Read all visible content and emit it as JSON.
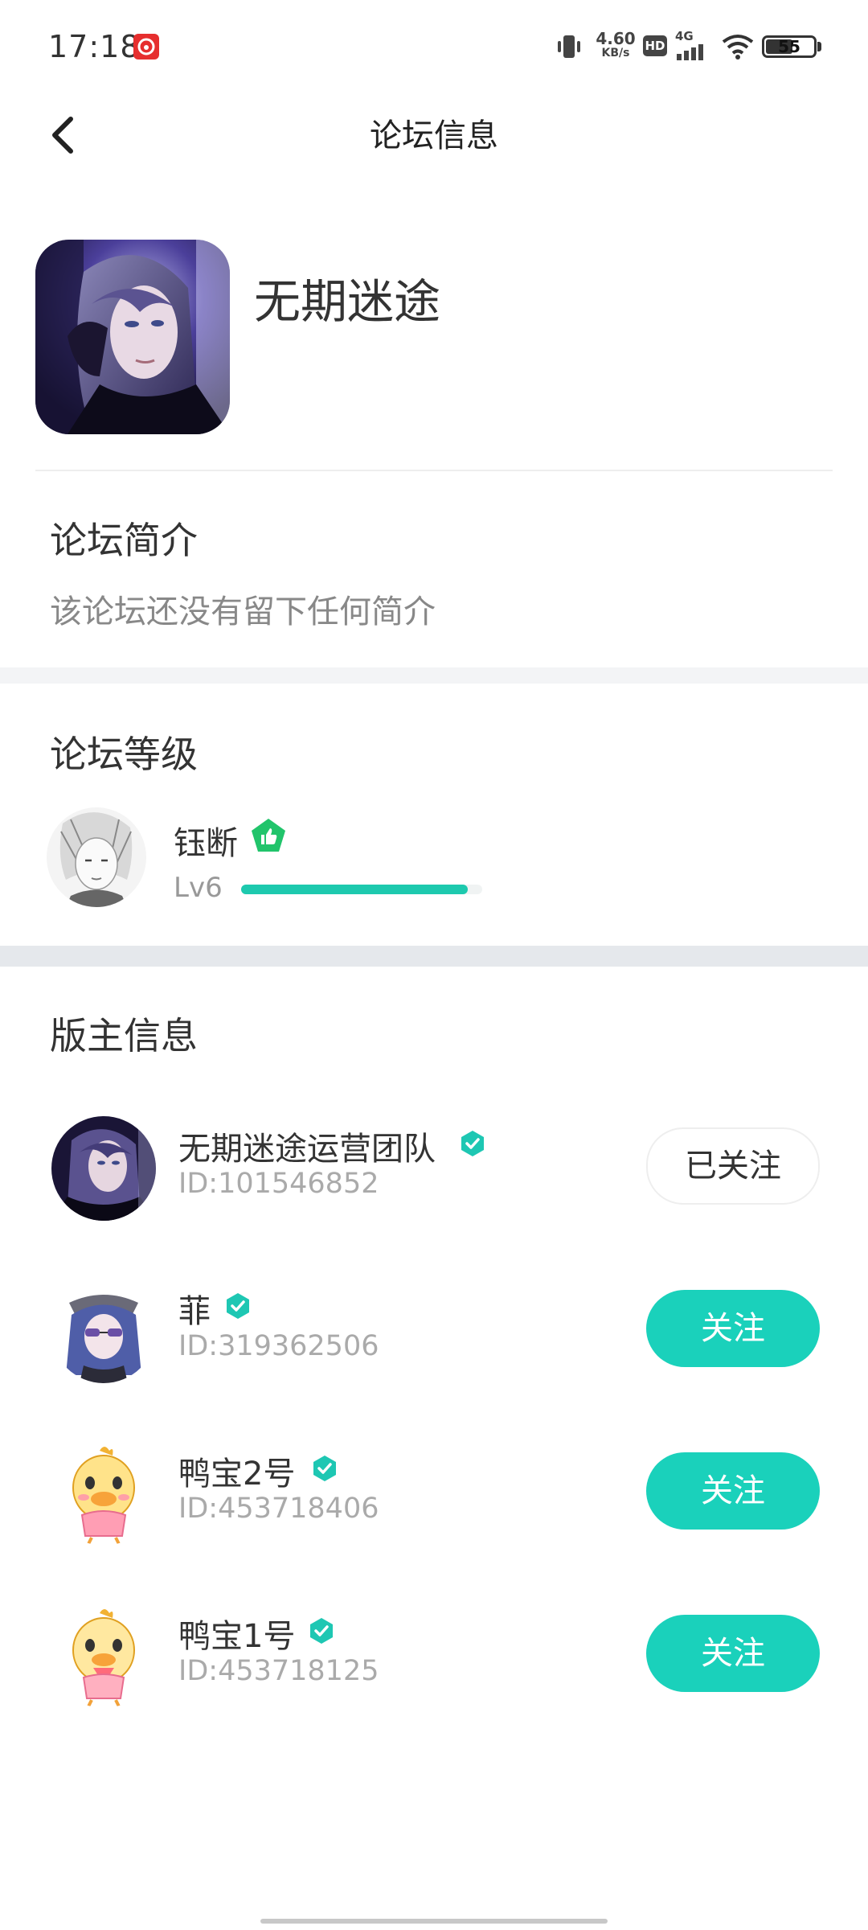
{
  "status_bar": {
    "time": "17:18",
    "net_speed_value": "4.60",
    "net_speed_unit": "KB/s",
    "hd_label": "HD",
    "network_type": "4G",
    "battery_level": "55"
  },
  "header": {
    "title": "论坛信息"
  },
  "forum": {
    "name": "无期迷途"
  },
  "intro": {
    "title": "论坛简介",
    "text": "该论坛还没有留下任何简介"
  },
  "level": {
    "title": "论坛等级",
    "user_name": "钰断",
    "level_label": "Lv6",
    "progress": 0.94
  },
  "moderators": {
    "title": "版主信息",
    "items": [
      {
        "name": "无期迷途运营团队",
        "id": "ID:101546852",
        "button": "已关注",
        "following": true
      },
      {
        "name": "菲",
        "id": "ID:319362506",
        "button": "关注",
        "following": false
      },
      {
        "name": "鸭宝2号",
        "id": "ID:453718406",
        "button": "关注",
        "following": false
      },
      {
        "name": "鸭宝1号",
        "id": "ID:453718125",
        "button": "关注",
        "following": false
      }
    ]
  },
  "colors": {
    "accent": "#1ad1bb",
    "progress": "#1dc9ae",
    "badge_green": "#21c46b",
    "section_gap": "#f3f4f6"
  }
}
